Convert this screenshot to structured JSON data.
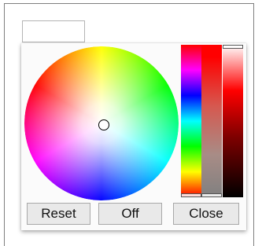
{
  "color_picker": {
    "input_value": "",
    "buttons": {
      "reset_label": "Reset",
      "off_label": "Off",
      "close_label": "Close"
    },
    "selected_color": "#ffffff",
    "hue_value": "#ff0000",
    "icons": {
      "wheel": "color-wheel",
      "handle": "circle-handle"
    }
  }
}
